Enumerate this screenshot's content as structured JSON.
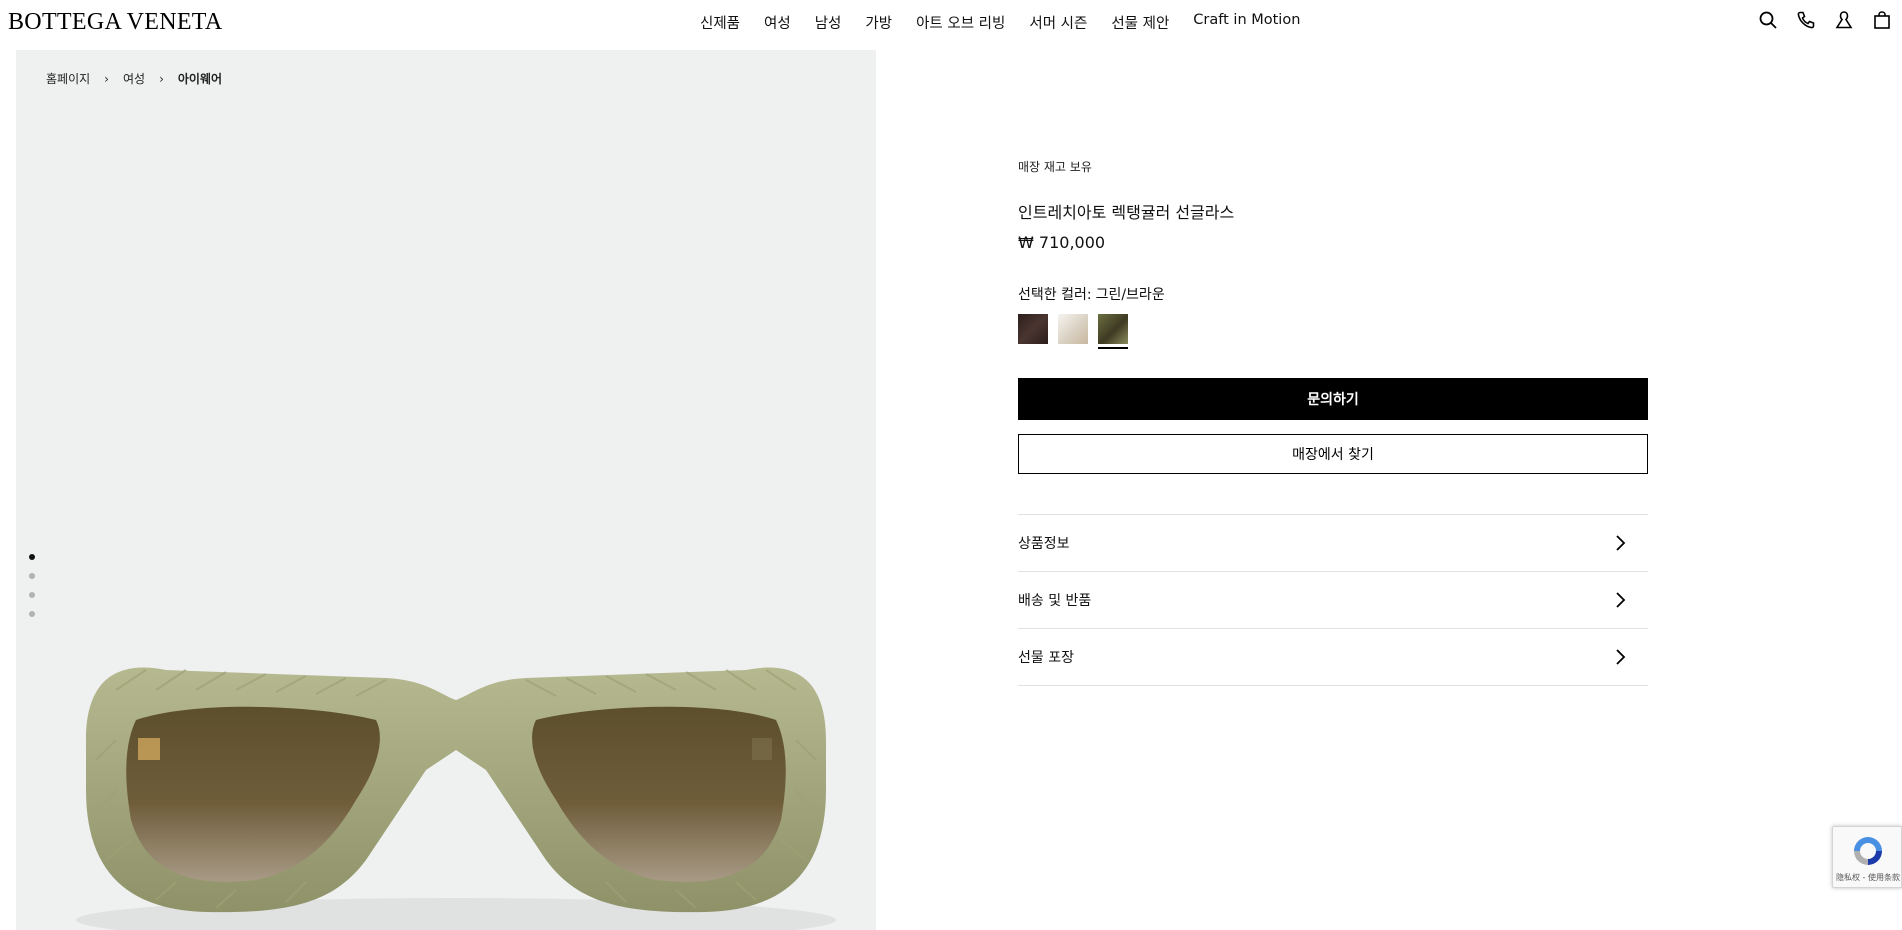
{
  "header": {
    "logo": "BOTTEGA VENETA",
    "nav": [
      "신제품",
      "여성",
      "남성",
      "가방",
      "아트 오브 리빙",
      "서머 시즌",
      "선물 제안",
      "Craft in Motion"
    ],
    "icons": [
      "search-icon",
      "phone-icon",
      "account-icon",
      "bag-icon"
    ]
  },
  "breadcrumb": {
    "items": [
      "홈페이지",
      "여성",
      "아이웨어"
    ]
  },
  "gallery": {
    "image_count": 4,
    "active_index": 0,
    "background": "#eff1f0"
  },
  "product": {
    "stock_label": "매장 재고 보유",
    "name": "인트레치아토 렉탱귤러 선글라스",
    "price": "₩ 710,000",
    "color_label": "선택한 컬러:",
    "color_value": "그린/브라운",
    "swatches": [
      {
        "name": "dark-brown",
        "color": "#3a2a26",
        "selected": false
      },
      {
        "name": "cream",
        "color": "#e8e4dc",
        "selected": false
      },
      {
        "name": "green",
        "color": "#5a5c3a",
        "selected": true
      }
    ],
    "primary_button": "문의하기",
    "secondary_button": "매장에서 찾기",
    "accordion": [
      "상품정보",
      "배송 및 반품",
      "선물 포장"
    ]
  },
  "recaptcha": {
    "text": "隐私权 - 使用条款"
  },
  "colors": {
    "accent": "#000000",
    "frame": "#a9ad86"
  }
}
